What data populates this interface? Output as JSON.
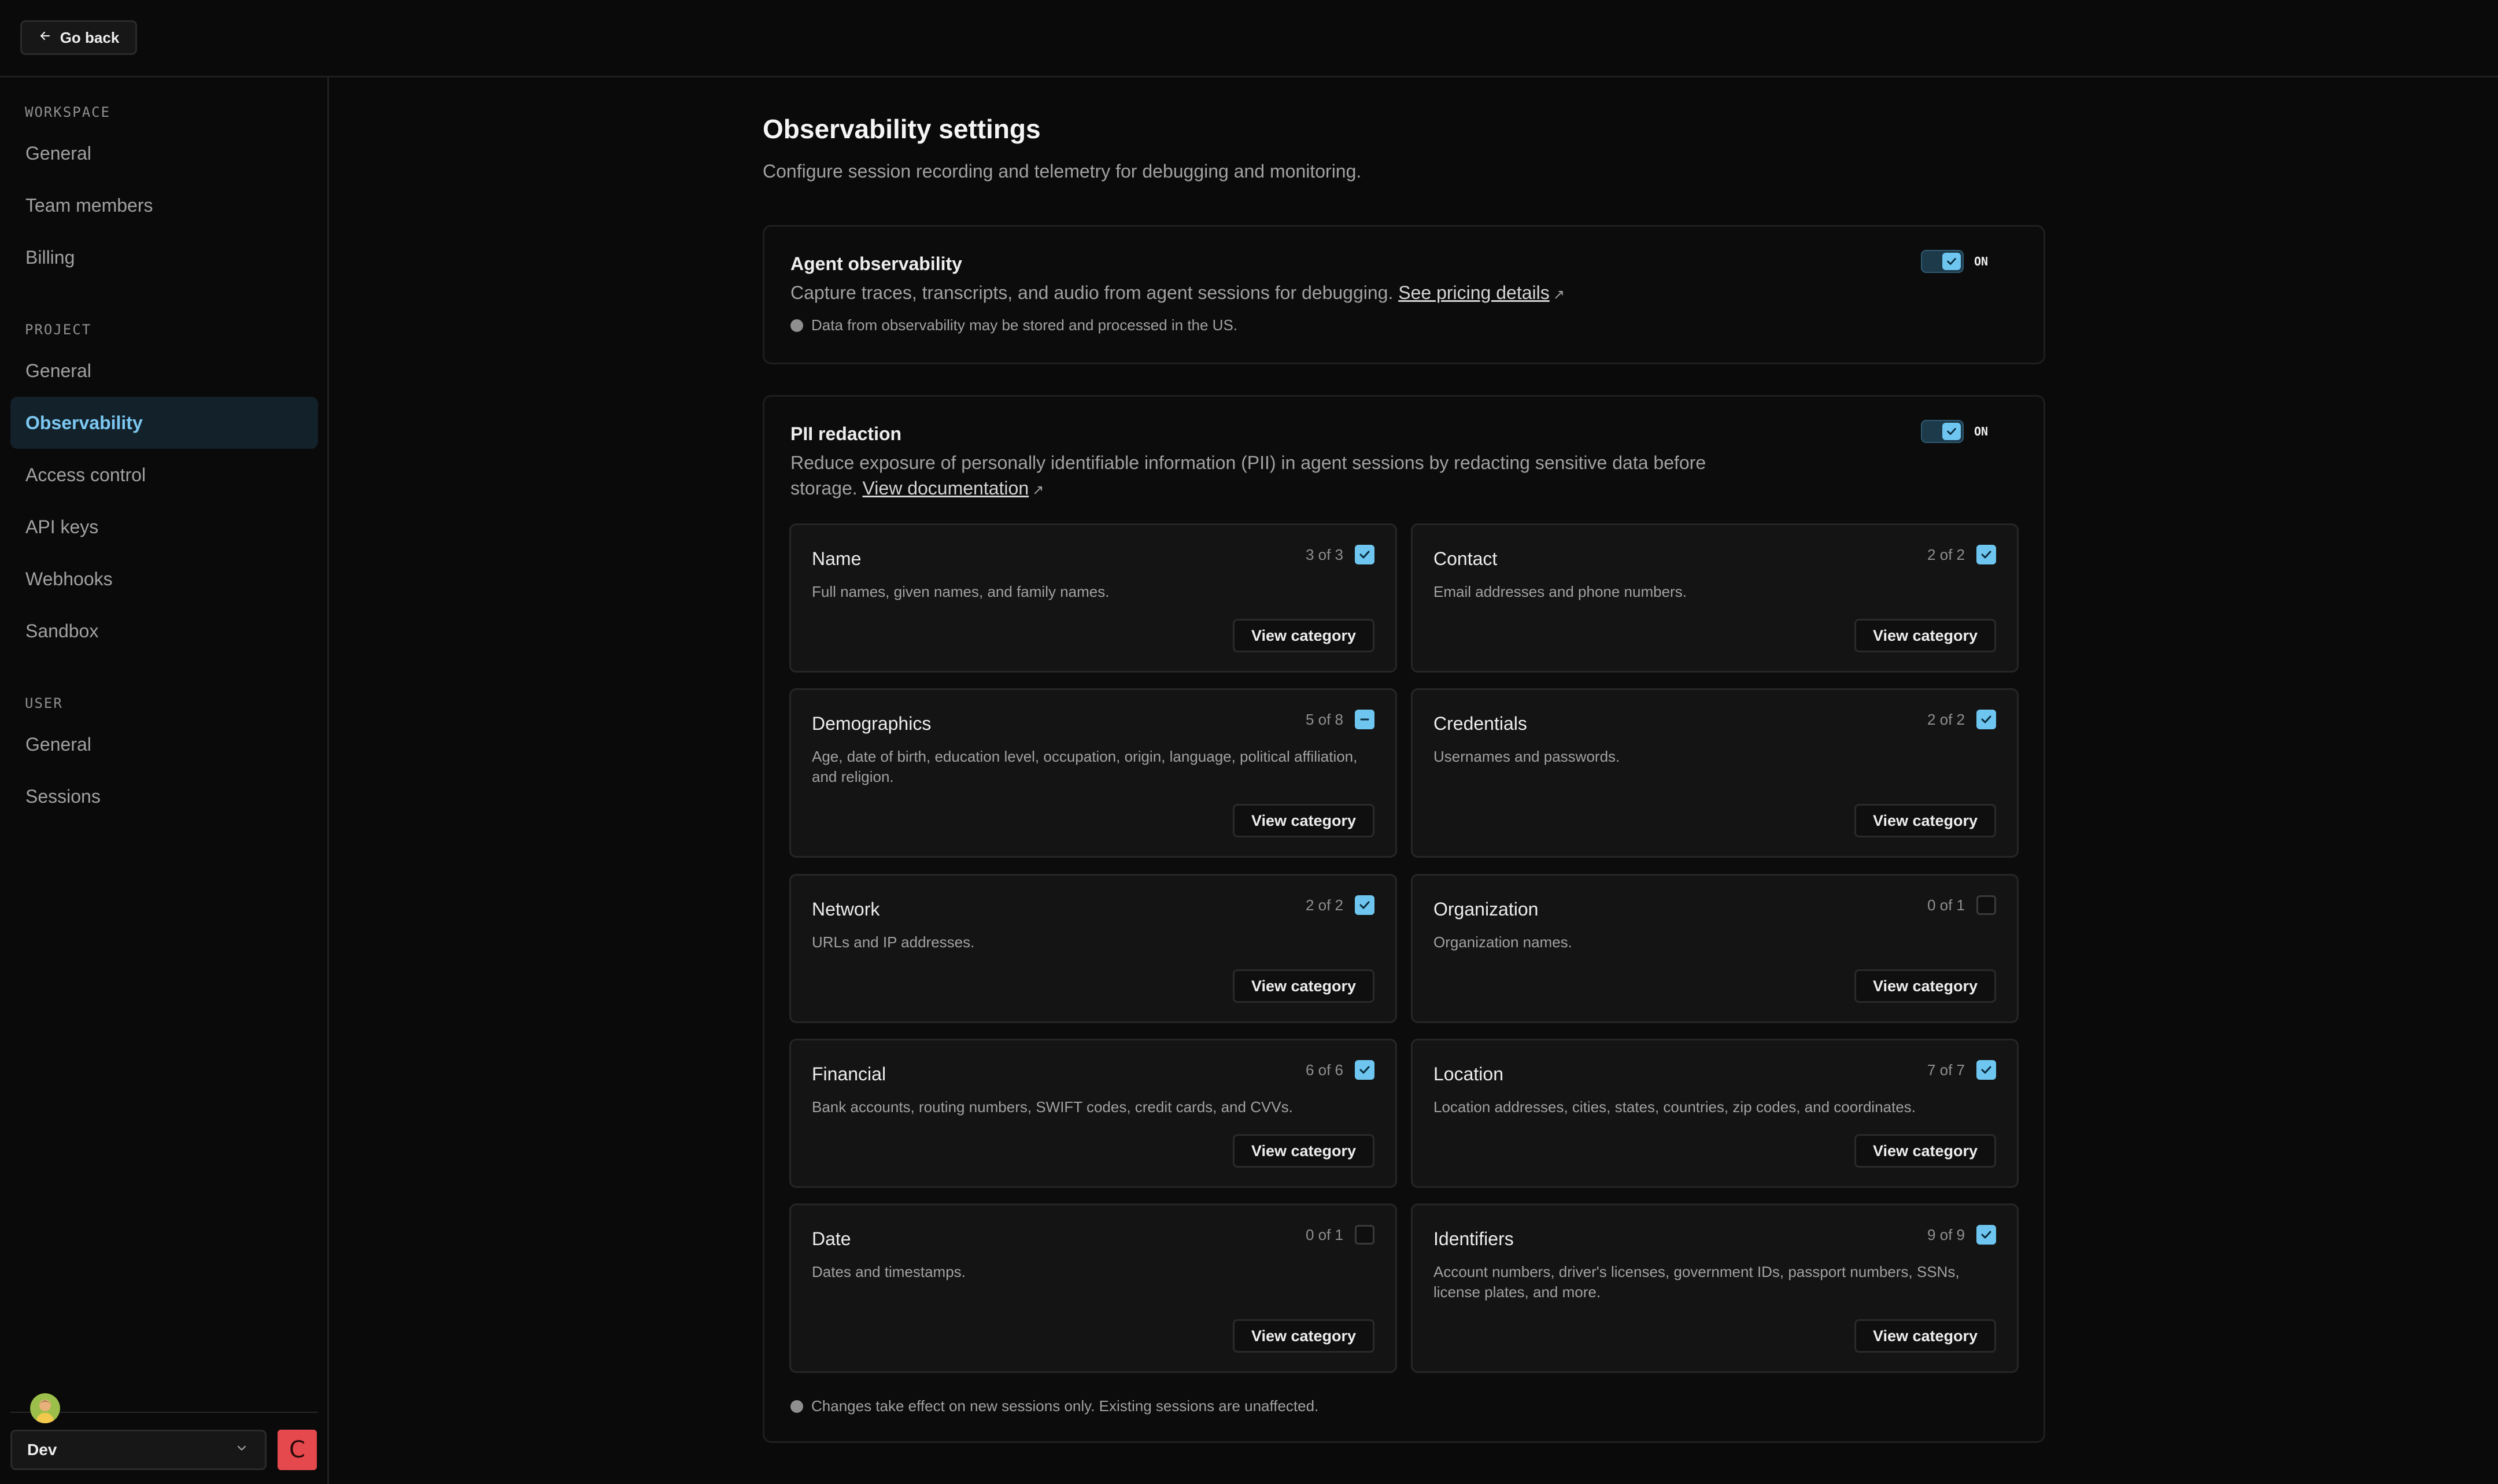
{
  "topbar": {
    "go_back_label": "Go back"
  },
  "sidebar": {
    "sections": [
      {
        "label": "WORKSPACE",
        "items": [
          "General",
          "Team members",
          "Billing"
        ]
      },
      {
        "label": "PROJECT",
        "items": [
          "General",
          "Observability",
          "Access control",
          "API keys",
          "Webhooks",
          "Sandbox"
        ]
      },
      {
        "label": "USER",
        "items": [
          "General",
          "Sessions"
        ]
      }
    ],
    "active_item": "Observability",
    "environment": "Dev",
    "org_initial": "C"
  },
  "page": {
    "title": "Observability settings",
    "subtitle": "Configure session recording and telemetry for debugging and monitoring."
  },
  "agent_observability": {
    "title": "Agent observability",
    "description": "Capture traces, transcripts, and audio from agent sessions for debugging.",
    "link_label": "See pricing details",
    "note": "Data from observability may be stored and processed in the US.",
    "toggle_state": "ON"
  },
  "pii_redaction": {
    "title": "PII redaction",
    "description": "Reduce exposure of personally identifiable information (PII) in agent sessions by redacting sensitive data before storage.",
    "link_label": "View documentation",
    "toggle_state": "ON",
    "footer_note": "Changes take effect on new sessions only. Existing sessions are unaffected.",
    "view_button_label": "View category",
    "categories": [
      {
        "name": "Name",
        "count": "3 of 3",
        "state": "checked",
        "description": "Full names, given names, and family names."
      },
      {
        "name": "Contact",
        "count": "2 of 2",
        "state": "checked",
        "description": "Email addresses and phone numbers."
      },
      {
        "name": "Demographics",
        "count": "5 of 8",
        "state": "partial",
        "description": "Age, date of birth, education level, occupation, origin, language, political affiliation, and religion."
      },
      {
        "name": "Credentials",
        "count": "2 of 2",
        "state": "checked",
        "description": "Usernames and passwords."
      },
      {
        "name": "Network",
        "count": "2 of 2",
        "state": "checked",
        "description": "URLs and IP addresses."
      },
      {
        "name": "Organization",
        "count": "0 of 1",
        "state": "unchecked",
        "description": "Organization names."
      },
      {
        "name": "Financial",
        "count": "6 of 6",
        "state": "checked",
        "description": "Bank accounts, routing numbers, SWIFT codes, credit cards, and CVVs."
      },
      {
        "name": "Location",
        "count": "7 of 7",
        "state": "checked",
        "description": "Location addresses, cities, states, countries, zip codes, and coordinates."
      },
      {
        "name": "Date",
        "count": "0 of 1",
        "state": "unchecked",
        "description": "Dates and timestamps."
      },
      {
        "name": "Identifiers",
        "count": "9 of 9",
        "state": "checked",
        "description": "Account numbers, driver's licenses, government IDs, passport numbers, SSNs, license plates, and more."
      }
    ]
  },
  "colors": {
    "background": "#0a0a0a",
    "accent": "#6ec6f0",
    "active_nav_bg": "#13212b",
    "org_badge": "#e5484d"
  },
  "icons": [
    "arrow-left-icon",
    "check-icon",
    "minus-icon",
    "external-link-icon",
    "info-icon",
    "chevron-down-icon"
  ]
}
